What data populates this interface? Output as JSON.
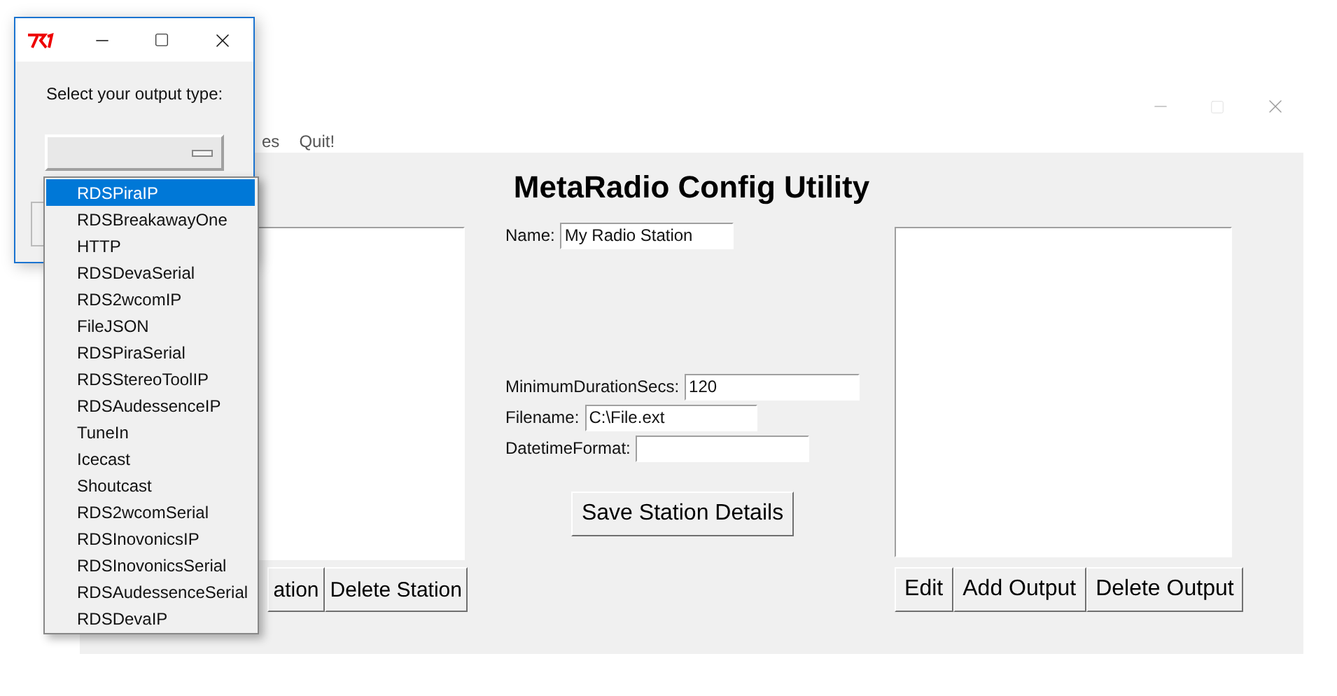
{
  "main_window": {
    "menu": [
      "es",
      "Quit!"
    ],
    "heading": "MetaRadio Config Utility",
    "name_field": {
      "label": "Name:",
      "value": "My Radio Station"
    },
    "fields": [
      {
        "label": "MinimumDurationSecs:",
        "value": "120"
      },
      {
        "label": "Filename:",
        "value": "C:\\File.ext"
      },
      {
        "label": "DatetimeFormat:"
      }
    ],
    "save_button": "Save Station Details",
    "station_buttons": [
      "ation",
      "Delete Station"
    ],
    "output_buttons": [
      "Edit",
      "Add Output",
      "Delete Output"
    ]
  },
  "dialog": {
    "prompt": "Select your output type:",
    "options": [
      {
        "label": "RDSPiraIP",
        "selected": true
      },
      {
        "label": "RDSBreakawayOne",
        "selected": false
      },
      {
        "label": "HTTP",
        "selected": false
      },
      {
        "label": "RDSDevaSerial",
        "selected": false
      },
      {
        "label": "RDS2wcomIP",
        "selected": false
      },
      {
        "label": "FileJSON",
        "selected": false
      },
      {
        "label": "RDSPiraSerial",
        "selected": false
      },
      {
        "label": "RDSStereoToolIP",
        "selected": false
      },
      {
        "label": "RDSAudessenceIP",
        "selected": false
      },
      {
        "label": "TuneIn",
        "selected": false
      },
      {
        "label": "Icecast",
        "selected": false
      },
      {
        "label": "Shoutcast",
        "selected": false
      },
      {
        "label": "RDS2wcomSerial",
        "selected": false
      },
      {
        "label": "RDSInovonicsIP",
        "selected": false
      },
      {
        "label": "RDSInovonicsSerial",
        "selected": false
      },
      {
        "label": "RDSAudessenceSerial",
        "selected": false
      },
      {
        "label": "RDSDevaIP",
        "selected": false
      }
    ]
  }
}
